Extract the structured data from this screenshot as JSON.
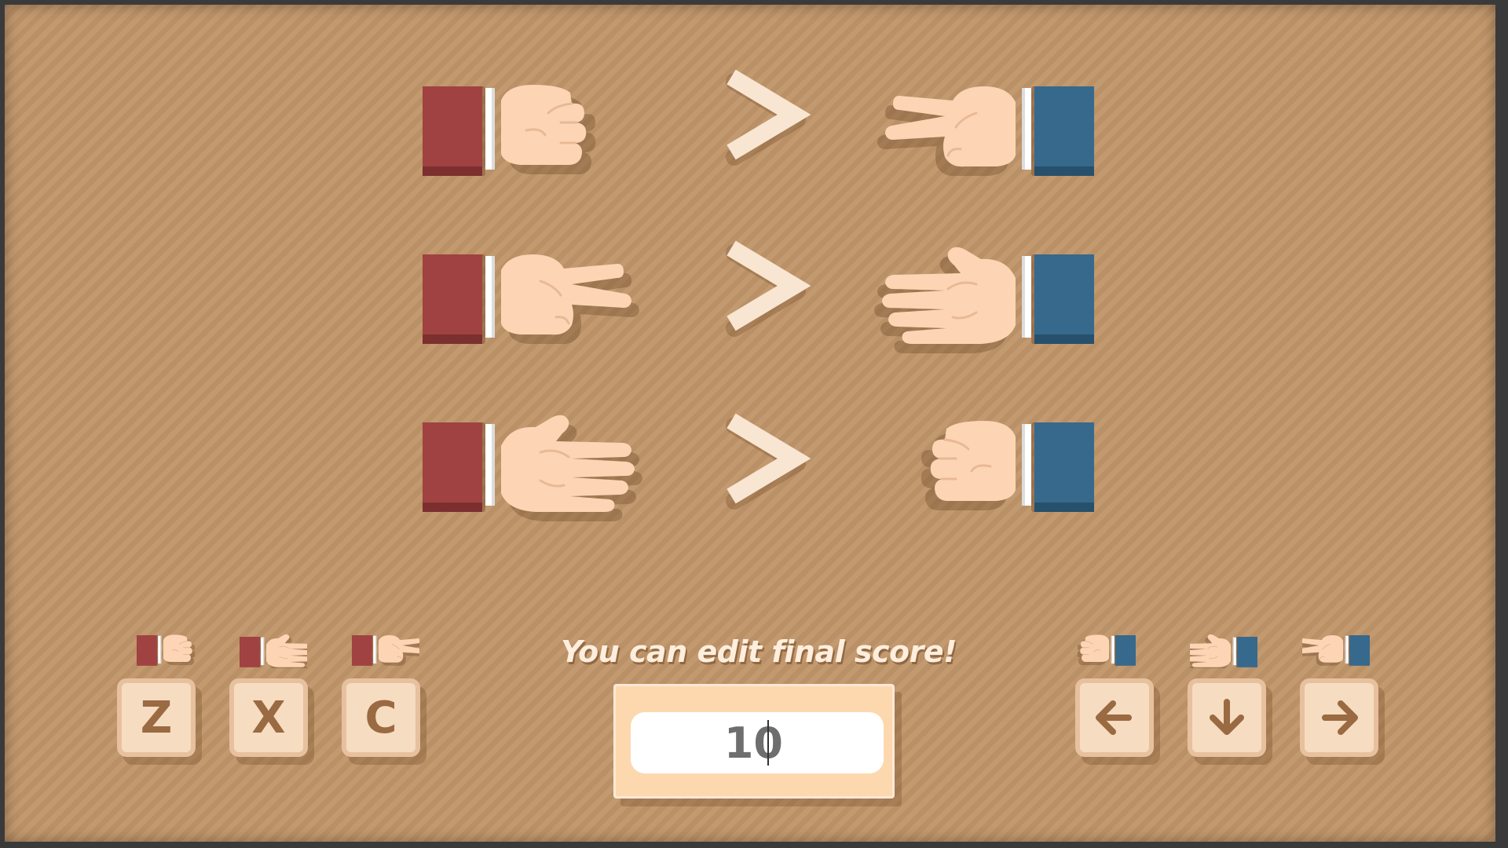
{
  "rules": [
    {
      "left_hand": "rock",
      "relation": "beats",
      "right_hand": "scissors"
    },
    {
      "left_hand": "scissors",
      "relation": "beats",
      "right_hand": "paper"
    },
    {
      "left_hand": "paper",
      "relation": "beats",
      "right_hand": "rock"
    }
  ],
  "colors": {
    "board": "#c1956a",
    "player1_sleeve": "#a04242",
    "player2_sleeve": "#37698c",
    "skin": "#fdd5b4",
    "key_face": "#f6dcc0",
    "key_text": "#9a6a42"
  },
  "player1_controls": [
    {
      "hand": "rock",
      "key": "Z"
    },
    {
      "hand": "paper",
      "key": "X"
    },
    {
      "hand": "scissors",
      "key": "C"
    }
  ],
  "player2_controls": [
    {
      "hand": "rock",
      "key": "left-arrow-icon"
    },
    {
      "hand": "paper",
      "key": "down-arrow-icon"
    },
    {
      "hand": "scissors",
      "key": "right-arrow-icon"
    }
  ],
  "score": {
    "title": "You can edit final score!",
    "value": "10"
  }
}
